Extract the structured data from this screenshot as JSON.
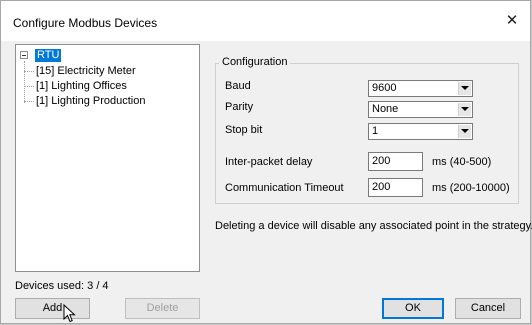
{
  "window": {
    "title": "Configure Modbus Devices",
    "close_symbol": "✕"
  },
  "tree": {
    "root": "RTU",
    "items": [
      "[15] Electricity Meter",
      "[1] Lighting Offices",
      "[1] Lighting Production"
    ]
  },
  "devices_used": "Devices used: 3 / 4",
  "buttons": {
    "add": "Add",
    "delete": "Delete",
    "ok": "OK",
    "cancel": "Cancel"
  },
  "configuration": {
    "group_title": "Configuration",
    "baud": {
      "label": "Baud",
      "value": "9600"
    },
    "parity": {
      "label": "Parity",
      "value": "None"
    },
    "stop_bit": {
      "label": "Stop bit",
      "value": "1"
    },
    "inter_packet_delay": {
      "label": "Inter-packet delay",
      "value": "200",
      "range": "ms (40-500)"
    },
    "communication_timeout": {
      "label": "Communication Timeout",
      "value": "200",
      "range": "ms (200-10000)"
    }
  },
  "note": "Deleting a device will disable any associated point in the strategy.",
  "colors": {
    "selection": "#0078d7",
    "dialog_bg": "#f0f0f0"
  },
  "icons": {
    "cursor": "mouse-pointer-icon",
    "expander": "collapse-minus-icon"
  }
}
